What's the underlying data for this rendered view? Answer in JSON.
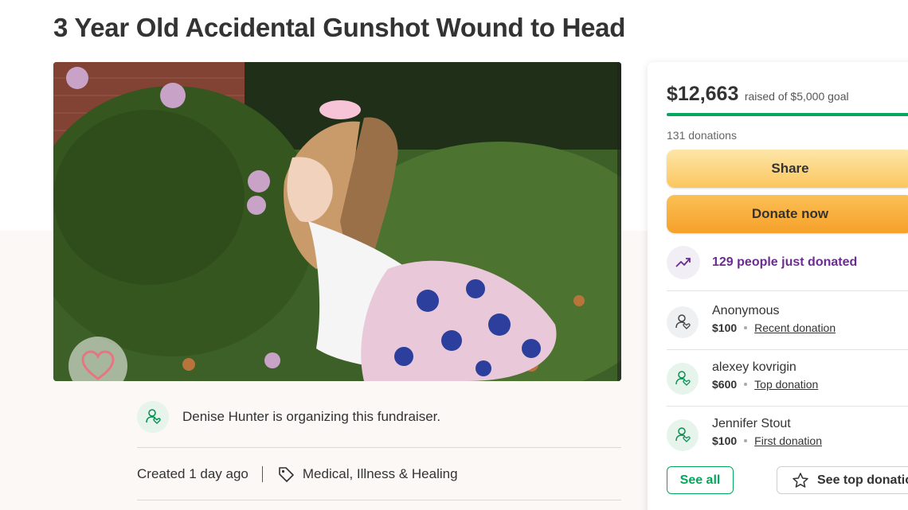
{
  "campaign": {
    "title": "3 Year Old Accidental Gunshot Wound to Head",
    "organizer_text": "Denise Hunter is organizing this fundraiser.",
    "created": "Created 1 day ago",
    "category": "Medical, Illness & Healing"
  },
  "funding": {
    "raised": "$12,663",
    "goal_text": "raised of $5,000 goal",
    "progress_fraction": 1.0,
    "donations_count": "131 donations",
    "share_label": "Share",
    "donate_label": "Donate now",
    "trend_text": "129 people just donated"
  },
  "donors": [
    {
      "name": "Anonymous",
      "amount": "$100",
      "tag": "Recent donation"
    },
    {
      "name": "alexey kovrigin",
      "amount": "$600",
      "tag": "Top donation"
    },
    {
      "name": "Jennifer Stout",
      "amount": "$100",
      "tag": "First donation"
    }
  ],
  "actions": {
    "see_all": "See all",
    "see_top": "See top donations"
  },
  "colors": {
    "brand_green": "#02a95c",
    "trend_purple": "#6b2c91",
    "share_button": "#fbc65e",
    "donate_button": "#f6a02a"
  },
  "icons": {
    "heart": "heart-icon",
    "organizer": "user-heart-icon",
    "tag": "tag-icon",
    "trend": "trending-up-icon",
    "star": "star-icon"
  }
}
